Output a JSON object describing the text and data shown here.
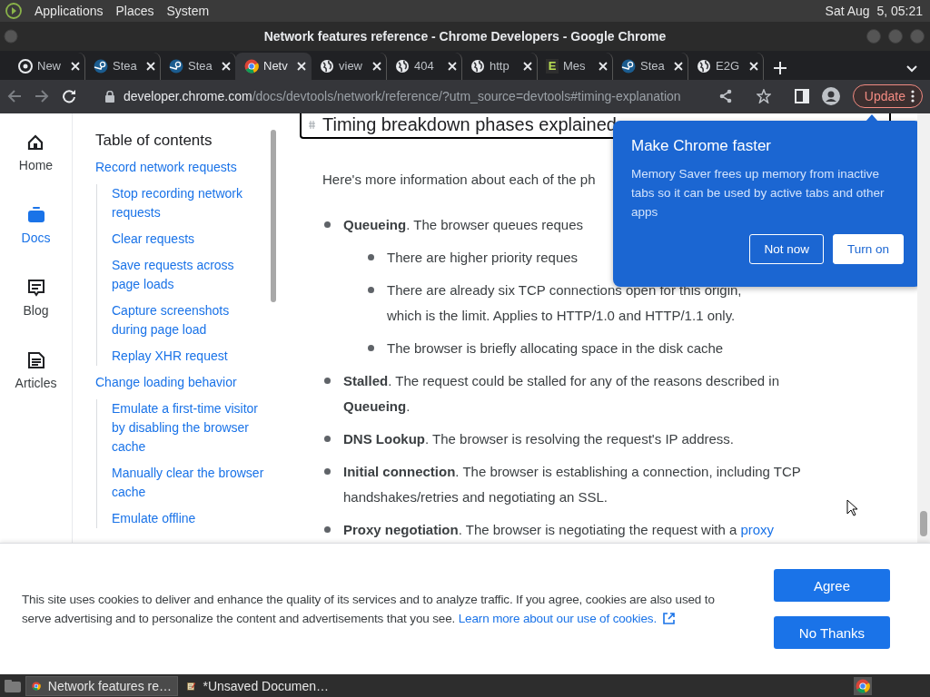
{
  "panel": {
    "menus": [
      "Applications",
      "Places",
      "System"
    ],
    "clock": "Sat Aug  5, 05:21"
  },
  "window": {
    "title": "Network features reference - Chrome Developers - Google Chrome"
  },
  "tabs": [
    {
      "label": "New",
      "kind": "newtab",
      "selected": false
    },
    {
      "label": "Stea",
      "kind": "steam",
      "selected": false
    },
    {
      "label": "Stea",
      "kind": "steam",
      "selected": false
    },
    {
      "label": "Netv",
      "kind": "chrome",
      "selected": true
    },
    {
      "label": "view",
      "kind": "globe",
      "selected": false
    },
    {
      "label": "404",
      "kind": "globe",
      "selected": false
    },
    {
      "label": "http",
      "kind": "globe",
      "selected": false
    },
    {
      "label": "Mes",
      "kind": "letter",
      "badge": "E",
      "selected": false
    },
    {
      "label": "Stea",
      "kind": "steam",
      "selected": false
    },
    {
      "label": "E2G",
      "kind": "globe",
      "selected": false
    }
  ],
  "address": {
    "host": "developer.chrome.com",
    "path": "/docs/devtools/network/reference/?utm_source=devtools#timing-explanation"
  },
  "update_button": "Update",
  "rail": [
    {
      "label": "Home",
      "kind": "home",
      "selected": false
    },
    {
      "label": "Docs",
      "kind": "docs",
      "selected": true
    },
    {
      "label": "Blog",
      "kind": "blog",
      "selected": false
    },
    {
      "label": "Articles",
      "kind": "articles",
      "selected": false
    }
  ],
  "toc": {
    "title": "Table of contents",
    "items": [
      {
        "label": "Record network requests",
        "children": [
          {
            "label": "Stop recording network requests"
          },
          {
            "label": "Clear requests"
          },
          {
            "label": "Save requests across page loads"
          },
          {
            "label": "Capture screenshots during page load"
          },
          {
            "label": "Replay XHR request"
          }
        ]
      },
      {
        "label": "Change loading behavior",
        "children": [
          {
            "label": "Emulate a first-time visitor by disabling the browser cache"
          },
          {
            "label": "Manually clear the browser cache"
          },
          {
            "label": "Emulate offline"
          }
        ]
      }
    ]
  },
  "article": {
    "heading": "Timing breakdown phases explained",
    "intro": "Here's more information about each of the ph",
    "items": [
      {
        "text": "**Queueing**. The browser queues reques",
        "children": [
          {
            "text": "There are higher priority reques"
          },
          {
            "text": "There are already six TCP connections open for this origin, which is the limit. Applies to HTTP/1.0 and HTTP/1.1 only."
          },
          {
            "text": "The browser is briefly allocating space in the disk cache"
          }
        ]
      },
      {
        "text": "**Stalled**. The request could be stalled for any of the reasons described in **Queueing**."
      },
      {
        "text": "**DNS Lookup**. The browser is resolving the request's IP address."
      },
      {
        "text": "**Initial connection**. The browser is establishing a connection, including TCP handshakes/retries and negotiating an SSL."
      },
      {
        "text": "**Proxy negotiation**. The browser is negotiating the request with a",
        "link": "proxy"
      }
    ]
  },
  "promo": {
    "title": "Make Chrome faster",
    "body": "Memory Saver frees up memory from inactive tabs so it can be used by active tabs and other apps",
    "buttons": [
      {
        "label": "Not now",
        "kind": "outline"
      },
      {
        "label": "Turn on",
        "kind": "filled"
      }
    ]
  },
  "cookies": {
    "text": "This site uses cookies to deliver and enhance the quality of its services and to analyze traffic. If you agree, cookies are also used to serve advertising and to personalize the content and advertisements that you see.",
    "link": "Learn more about our use of cookies.",
    "buttons": [
      "Agree",
      "No Thanks"
    ]
  },
  "taskbar": [
    {
      "label": "Network features re…",
      "kind": "chrome",
      "selected": true
    },
    {
      "label": "*Unsaved Documen…",
      "kind": "editor",
      "selected": false
    }
  ]
}
